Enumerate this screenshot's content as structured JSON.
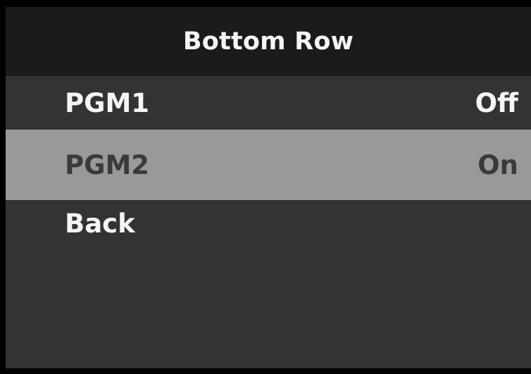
{
  "title": "Bottom Row",
  "menu": [
    {
      "label": "PGM1",
      "value": "Off",
      "selected": false
    },
    {
      "label": "PGM2",
      "value": "On",
      "selected": true
    },
    {
      "label": "Back",
      "value": "",
      "selected": false
    }
  ],
  "colors": {
    "frame": "#000000",
    "title_bar": "#1b1b1b",
    "panel": "#333333",
    "selected_row": "#999999",
    "text": "#f5f5f5",
    "selected_text": "#3a3a3a"
  }
}
